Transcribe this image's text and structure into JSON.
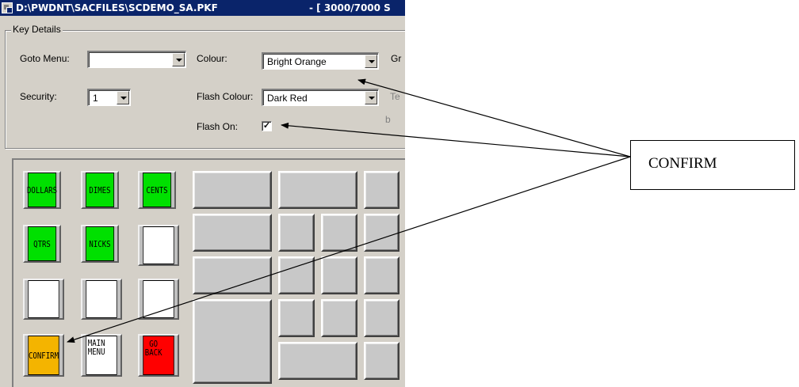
{
  "window": {
    "title": "D:\\PWDNT\\SACFILES\\SCDEMO_SA.PKF",
    "title_suffix": "- [ 3000/7000 S",
    "icon": "app-icon"
  },
  "key_details": {
    "group_label": "Key Details",
    "goto_menu_label": "Goto Menu:",
    "goto_menu_value": "",
    "security_label": "Security:",
    "security_value": "1",
    "colour_label": "Colour:",
    "colour_value": "Bright Orange",
    "flash_colour_label": "Flash Colour:",
    "flash_colour_value": "Dark Red",
    "flash_on_label": "Flash On:",
    "flash_on_checked": true,
    "flash_on_mark": "✓",
    "cut_label_1": "Gr",
    "cut_label_2": "Te",
    "cut_label_3": "b"
  },
  "keys": {
    "dollars": "DOLLARS",
    "dimes": "DIMES",
    "cents": "CENTS",
    "qtrs": "QTRS",
    "nicks": "NICKS",
    "confirm": "CONFIRM",
    "main_menu": "MAIN\nMENU",
    "go_back": "GO\nBACK"
  },
  "colors": {
    "green_key": "#00e000",
    "confirm_key": "#f4b400",
    "go_back_key": "#ff0000",
    "titlebar": "#0a246a"
  },
  "callout": {
    "text": "CONFIRM"
  }
}
